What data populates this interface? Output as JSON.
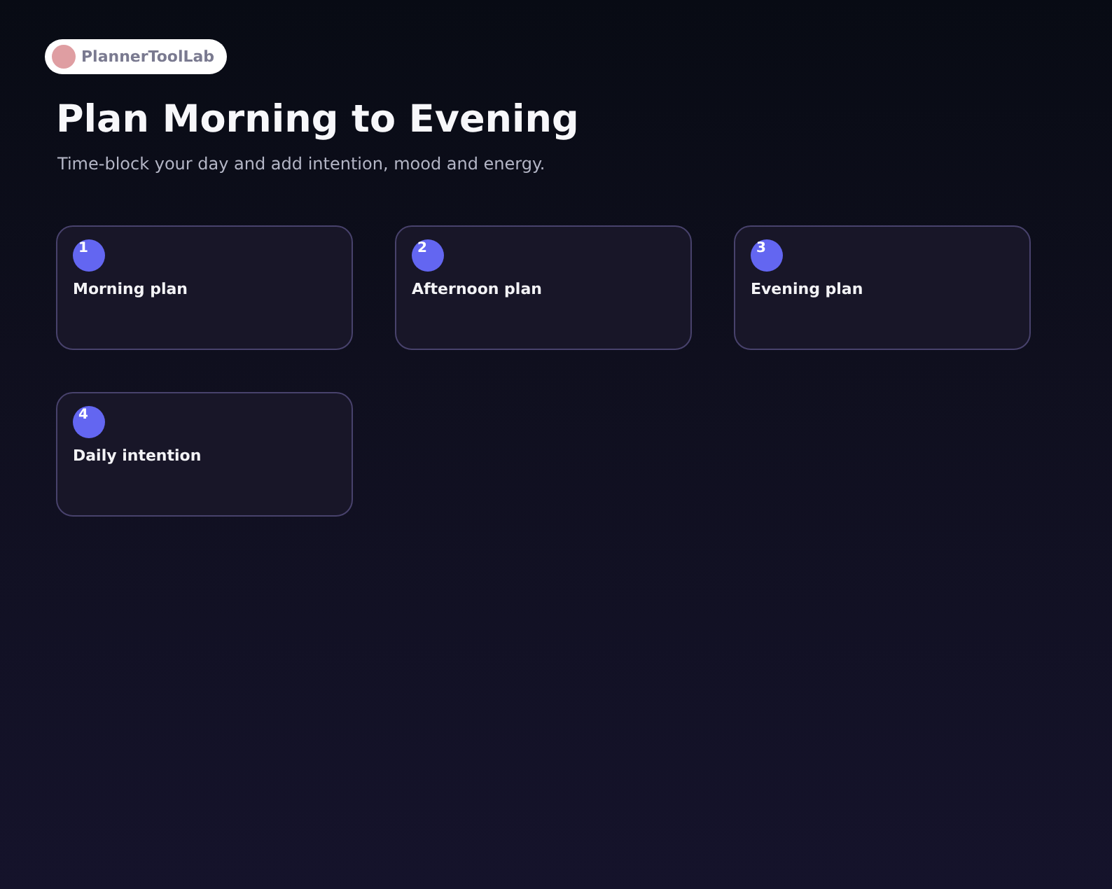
{
  "brand": {
    "name": "PlannerToolLab"
  },
  "heading": {
    "title": "Plan Morning to Evening",
    "subtitle": "Time-block your day and add intention, mood and energy."
  },
  "cards": [
    {
      "number": "1",
      "title": "Morning plan"
    },
    {
      "number": "2",
      "title": "Afternoon plan"
    },
    {
      "number": "3",
      "title": "Evening plan"
    },
    {
      "number": "4",
      "title": "Daily intention"
    }
  ]
}
